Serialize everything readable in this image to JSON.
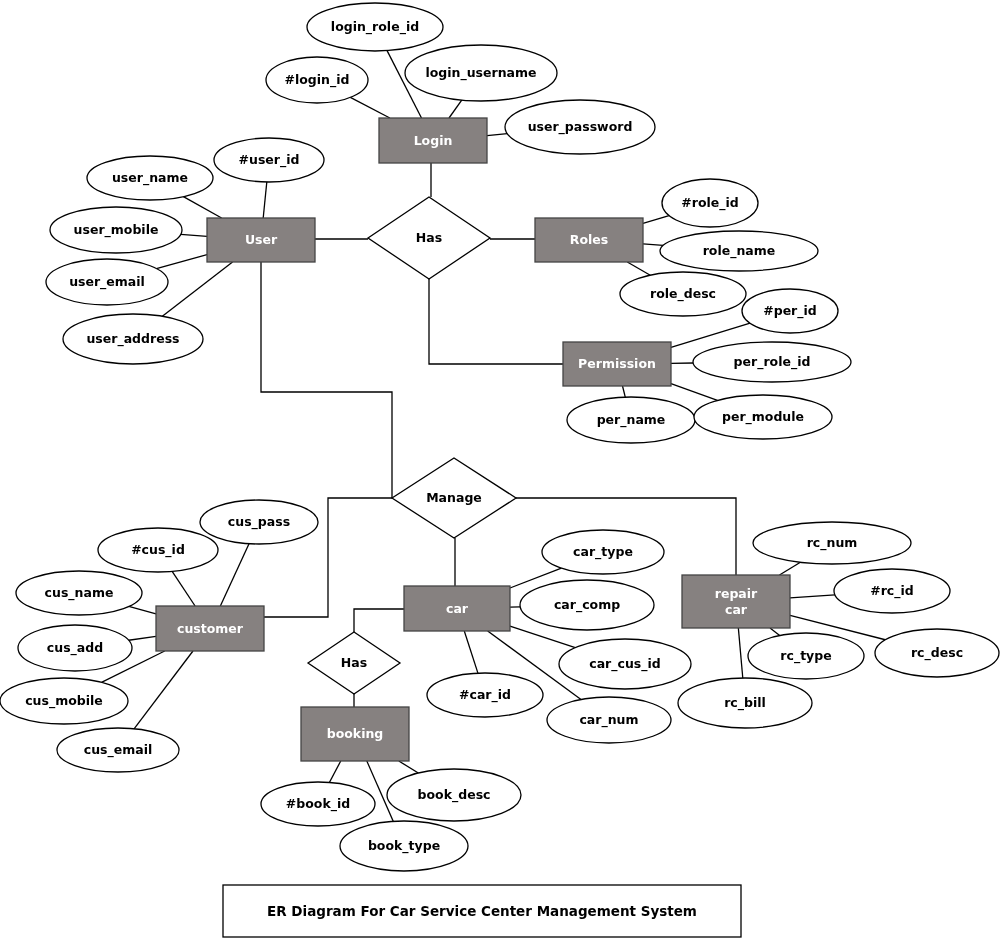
{
  "entities": [
    {
      "name": "Login",
      "attributes": [
        "login_role_id",
        "#login_id",
        "login_username",
        "user_password"
      ]
    },
    {
      "name": "User",
      "attributes": [
        "#user_id",
        "user_name",
        "user_mobile",
        "user_email",
        "user_address"
      ]
    },
    {
      "name": "Roles",
      "attributes": [
        "#role_id",
        "role_name",
        "role_desc"
      ]
    },
    {
      "name": "Permission",
      "attributes": [
        "#per_id",
        "per_role_id",
        "per_name",
        "per_module"
      ]
    },
    {
      "name": "customer",
      "attributes": [
        "cus_pass",
        "#cus_id",
        "cus_name",
        "cus_add",
        "cus_mobile",
        "cus_email"
      ]
    },
    {
      "name": "car",
      "attributes": [
        "car_type",
        "car_comp",
        "car_cus_id",
        "#car_id",
        "car_num"
      ]
    },
    {
      "name": "repair car",
      "attributes": [
        "rc_num",
        "#rc_id",
        "rc_type",
        "rc_desc",
        "rc_bill"
      ]
    },
    {
      "name": "booking",
      "attributes": [
        "#book_id",
        "book_desc",
        "book_type"
      ]
    }
  ],
  "relationships": [
    {
      "label": "Has"
    },
    {
      "label": "Manage"
    },
    {
      "label": "Has"
    }
  ],
  "title": "ER Diagram For Car Service Center Management System"
}
